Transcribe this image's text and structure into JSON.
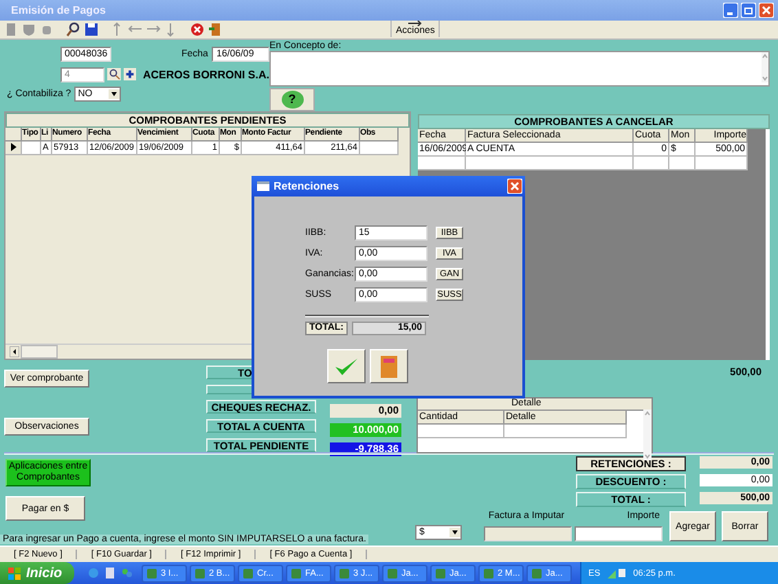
{
  "window": {
    "title": "Emisión de Pagos"
  },
  "toolbar": {
    "actions_button": "Acciones"
  },
  "header": {
    "number": "00048036",
    "date_label": "Fecha",
    "date": "16/06/09",
    "supplier_code": "4",
    "supplier_name": "ACEROS BORRONI S.A.",
    "accounting_label": "¿ Contabiliza ?",
    "accounting": "NO",
    "concept_label": "En Concepto de:",
    "help_button": "?"
  },
  "pending": {
    "title": "COMPROBANTES PENDIENTES",
    "columns": [
      "Tipo",
      "Li",
      "Numero",
      "Fecha",
      "Vencimient",
      "Cuota",
      "Mon",
      "Monto Factur",
      "Pendiente",
      "Obs"
    ],
    "rows": [
      {
        "selected": true,
        "cells": [
          null,
          "A",
          "57913",
          "12/06/2009",
          "19/06/2009",
          "1",
          "$",
          "411,64",
          "211,64",
          null
        ]
      }
    ]
  },
  "to_cancel": {
    "title": "COMPROBANTES A CANCELAR",
    "columns": [
      "Fecha",
      "Factura Seleccionada",
      "Cuota",
      "Mon",
      "Importe"
    ],
    "rows": [
      [
        "16/06/2009",
        "A CUENTA",
        "0",
        "$",
        "500,00"
      ]
    ]
  },
  "side_buttons": [
    "Ver comprobante",
    "Observaciones"
  ],
  "covered_label": "TO",
  "totals": [
    {
      "label": "CHEQUES RECHAZ.",
      "value": "0,00",
      "color": "#ece9d8"
    },
    {
      "label": "TOTAL A CUENTA",
      "value": "10.000,00",
      "color": "#22c022"
    },
    {
      "label": "TOTAL PENDIENTE",
      "value": "-9.788,36",
      "color": "#1414e6"
    }
  ],
  "grid_total": "500,00",
  "detail": {
    "title": "Detalle",
    "columns": [
      "Cantidad",
      "Detalle"
    ]
  },
  "applications_button": "Aplicaciones entre Comprobantes",
  "pay_button": "Pagar en $",
  "summary": [
    {
      "label": "RETENCIONES :",
      "value": "0,00",
      "kind": "display"
    },
    {
      "label": "DESCUENTO :",
      "value": "0,00",
      "kind": "input"
    },
    {
      "label": "TOTAL :",
      "value": "500,00",
      "kind": "display"
    }
  ],
  "entry": {
    "currency": "$",
    "invoice_label": "Factura a Imputar",
    "amount_label": "Importe",
    "buttons": [
      "Agregar",
      "Borrar"
    ]
  },
  "hint": "Para ingresar un Pago a cuenta, ingrese el monto SIN IMPUTARSELO a una factura.",
  "function_keys": [
    "[ F2 Nuevo ]",
    "[ F10 Guardar ]",
    "[ F12 Imprimir ]",
    "[ F6 Pago a Cuenta ]"
  ],
  "dialog": {
    "title": "Retenciones",
    "fields": [
      {
        "label": "IIBB:",
        "value": "15",
        "button": "IIBB"
      },
      {
        "label": "IVA:",
        "value": "0,00",
        "button": "IVA"
      },
      {
        "label": "Ganancias:",
        "value": "0,00",
        "button": "GAN"
      },
      {
        "label": "SUSS",
        "value": "0,00",
        "button": "SUSS"
      }
    ],
    "total_label": "TOTAL:",
    "total": "15,00"
  },
  "taskbar": {
    "start": "Inicio",
    "tasks": [
      "3 I...",
      "2 B...",
      "Cr...",
      "FA...",
      "3 J...",
      "Ja...",
      "Ja...",
      "2 M...",
      "Ja..."
    ],
    "language": "ES",
    "clock": "06:25 p.m."
  }
}
